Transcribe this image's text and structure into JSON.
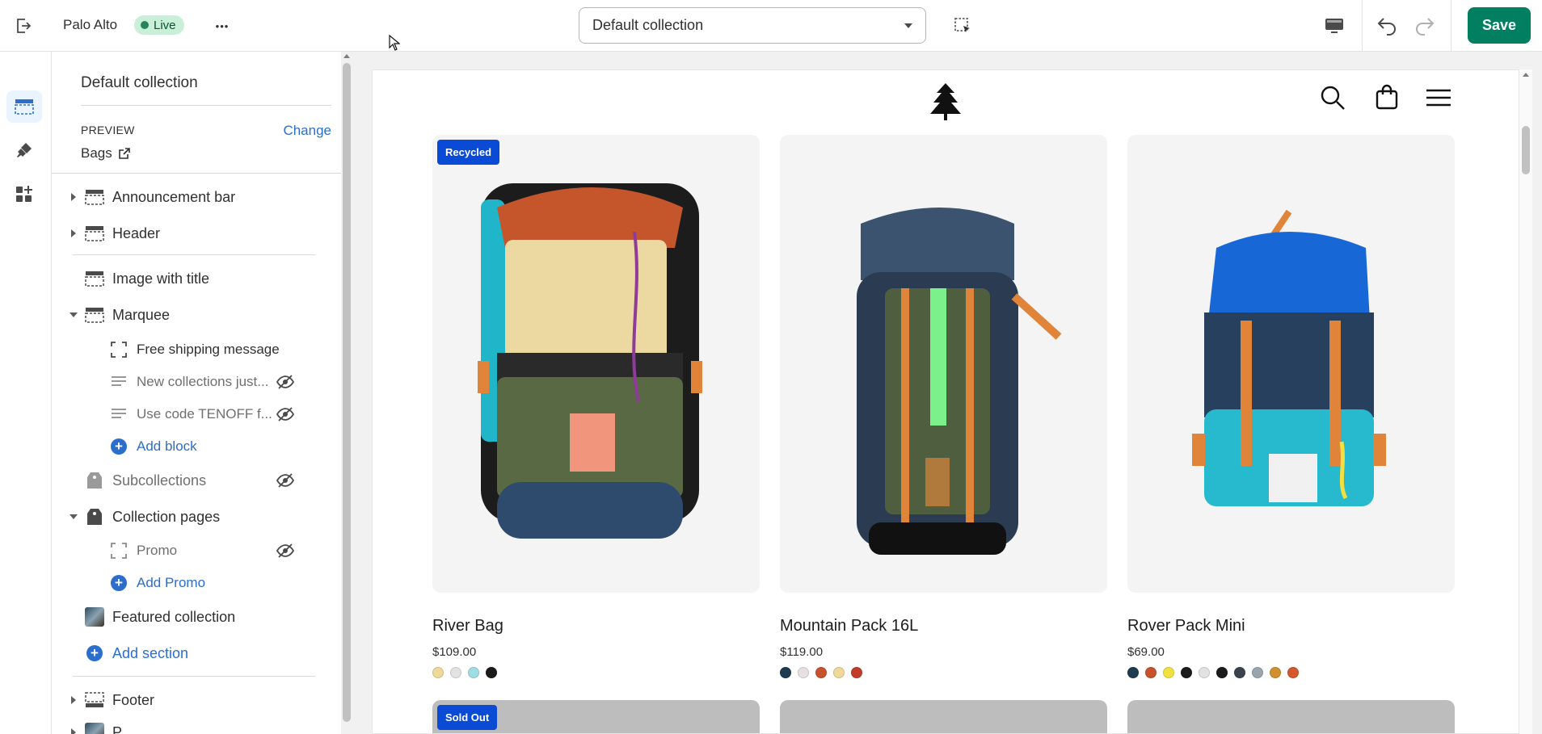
{
  "topbar": {
    "theme_name": "Palo Alto",
    "status_badge": "Live",
    "more_label": "•••",
    "collection_select": "Default collection",
    "save_label": "Save"
  },
  "panel": {
    "title": "Default collection",
    "preview_label": "PREVIEW",
    "change_label": "Change",
    "preview_value": "Bags",
    "items": [
      {
        "label": "Announcement bar"
      },
      {
        "label": "Header"
      },
      {
        "label": "Image with title"
      },
      {
        "label": "Marquee"
      },
      {
        "label": "Free shipping message"
      },
      {
        "label": "New collections just..."
      },
      {
        "label": "Use code TENOFF f..."
      },
      {
        "label": "Add block"
      },
      {
        "label": "Subcollections"
      },
      {
        "label": "Collection pages"
      },
      {
        "label": "Promo"
      },
      {
        "label": "Add Promo"
      },
      {
        "label": "Featured collection"
      },
      {
        "label": "Add section"
      },
      {
        "label": "Footer"
      },
      {
        "label": "P..."
      }
    ]
  },
  "products": [
    {
      "name": "River Bag",
      "price": "$109.00",
      "badge": "Recycled",
      "swatches": [
        "#f0d79a",
        "#e2e2e2",
        "#9fdde2",
        "#1b1b1b"
      ]
    },
    {
      "name": "Mountain Pack 16L",
      "price": "$119.00",
      "badge": "",
      "swatches": [
        "#1f3b4f",
        "#e6e0e0",
        "#c6522e",
        "#f0d79a",
        "#c13d2a"
      ]
    },
    {
      "name": "Rover Pack Mini",
      "price": "$69.00",
      "badge": "",
      "swatches": [
        "#1f3b4f",
        "#c6522e",
        "#f0e040",
        "#1b1b1b",
        "#e2e2e2",
        "#1b1b1b",
        "#3b434d",
        "#9aa4ad",
        "#d1902e",
        "#d4582c"
      ]
    }
  ],
  "row2": {
    "badge": "Sold Out"
  },
  "colors": {
    "accent": "#2c6ecb",
    "save": "#008060",
    "badge": "#0a4bd6",
    "live_bg": "#c9efd9"
  }
}
